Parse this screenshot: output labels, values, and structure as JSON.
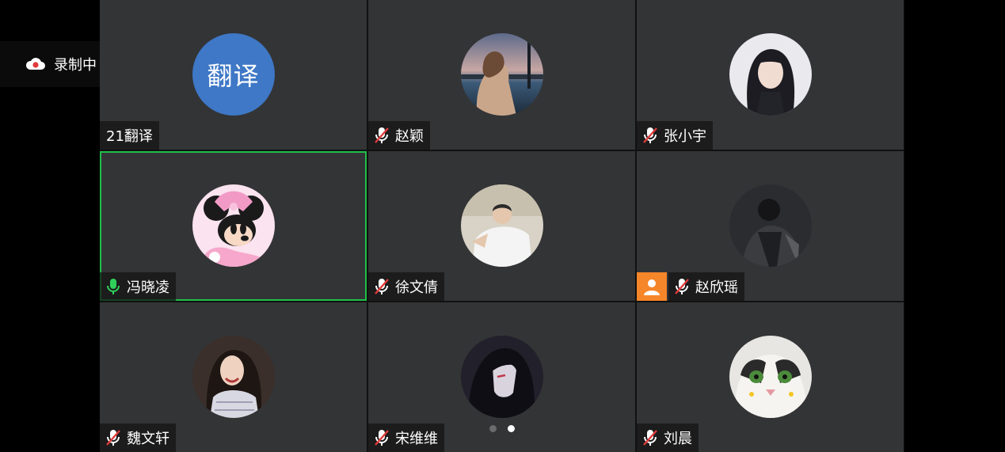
{
  "recording": {
    "icon": "cloud-record-icon",
    "label": "录制中"
  },
  "participants": [
    {
      "name": "21翻译",
      "avatar_text": "翻译",
      "avatar_type": "text",
      "mic": "none",
      "avatar_color": "#3e78c6"
    },
    {
      "name": "赵颖",
      "avatar_type": "photo",
      "mic": "muted"
    },
    {
      "name": "张小宇",
      "avatar_type": "photo",
      "mic": "muted"
    },
    {
      "name": "冯晓凌",
      "avatar_type": "photo",
      "mic": "active",
      "speaking": true
    },
    {
      "name": "徐文倩",
      "avatar_type": "photo",
      "mic": "muted"
    },
    {
      "name": "赵欣瑶",
      "avatar_type": "photo",
      "mic": "muted",
      "badge": "user-icon"
    },
    {
      "name": "魏文轩",
      "avatar_type": "photo",
      "mic": "muted"
    },
    {
      "name": "宋维维",
      "avatar_type": "photo",
      "mic": "muted"
    },
    {
      "name": "刘晨",
      "avatar_type": "photo",
      "mic": "muted"
    }
  ],
  "pagination": {
    "total": 2,
    "current": 2
  },
  "colors": {
    "speaking_border": "#1fbf4a",
    "mic_active": "#2fd05a",
    "mic_muted_slash": "#e23b3b",
    "host_badge": "#f5862a"
  }
}
